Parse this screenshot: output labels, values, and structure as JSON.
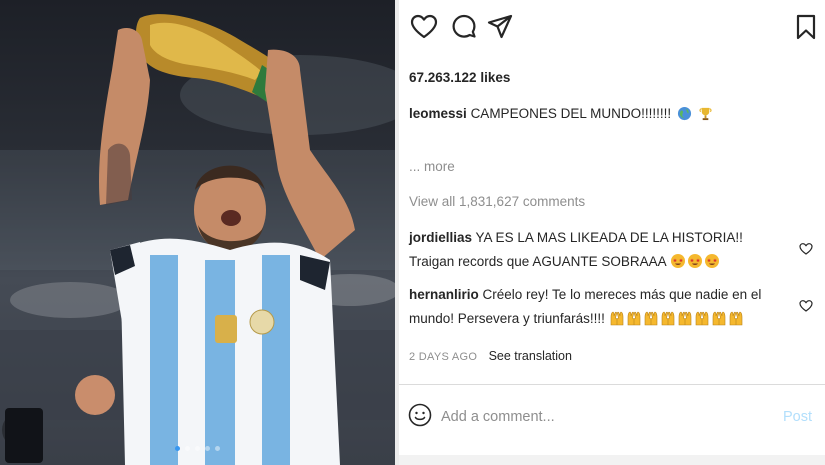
{
  "post": {
    "likes": "67.263.122 likes",
    "caption_user": "leomessi",
    "caption_text": "CAMPEONES DEL MUNDO!!!!!!!!",
    "more": "... more",
    "view_all": "View all 1,831,627 comments"
  },
  "comments": [
    {
      "user": "jordiellias",
      "text": "YA ES LA MAS LIKEADA DE LA HISTORIA!! Traigan records que AGUANTE SOBRAAA"
    },
    {
      "user": "hernanlirio",
      "text": "Créelo rey! Te lo mereces más que nadie en el mundo! Persevera y triunfarás!!!!"
    }
  ],
  "meta": {
    "time": "2 DAYS AGO",
    "see_translation": "See translation"
  },
  "composer": {
    "placeholder": "Add a comment...",
    "post_label": "Post"
  },
  "icons": {
    "like": "heart-icon",
    "comment": "comment-bubble-icon",
    "share": "paper-plane-icon",
    "save": "bookmark-icon",
    "emoji": "smiley-icon"
  },
  "colors": {
    "link_blue": "#b2dffc",
    "muted": "#8e8e8e",
    "text": "#262626"
  }
}
